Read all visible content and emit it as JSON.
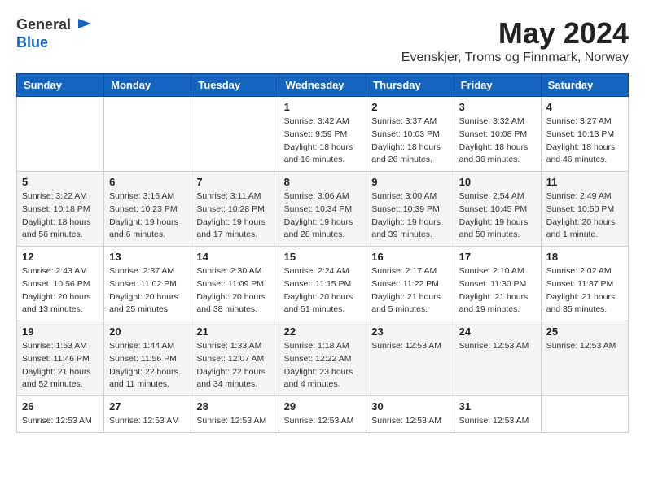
{
  "header": {
    "logo": {
      "line1": "General",
      "line2": "Blue"
    },
    "title": "May 2024",
    "location": "Evenskjer, Troms og Finnmark, Norway"
  },
  "weekdays": [
    "Sunday",
    "Monday",
    "Tuesday",
    "Wednesday",
    "Thursday",
    "Friday",
    "Saturday"
  ],
  "weeks": [
    [
      {
        "day": "",
        "detail": ""
      },
      {
        "day": "",
        "detail": ""
      },
      {
        "day": "",
        "detail": ""
      },
      {
        "day": "1",
        "detail": "Sunrise: 3:42 AM\nSunset: 9:59 PM\nDaylight: 18 hours and 16 minutes."
      },
      {
        "day": "2",
        "detail": "Sunrise: 3:37 AM\nSunset: 10:03 PM\nDaylight: 18 hours and 26 minutes."
      },
      {
        "day": "3",
        "detail": "Sunrise: 3:32 AM\nSunset: 10:08 PM\nDaylight: 18 hours and 36 minutes."
      },
      {
        "day": "4",
        "detail": "Sunrise: 3:27 AM\nSunset: 10:13 PM\nDaylight: 18 hours and 46 minutes."
      }
    ],
    [
      {
        "day": "5",
        "detail": "Sunrise: 3:22 AM\nSunset: 10:18 PM\nDaylight: 18 hours and 56 minutes."
      },
      {
        "day": "6",
        "detail": "Sunrise: 3:16 AM\nSunset: 10:23 PM\nDaylight: 19 hours and 6 minutes."
      },
      {
        "day": "7",
        "detail": "Sunrise: 3:11 AM\nSunset: 10:28 PM\nDaylight: 19 hours and 17 minutes."
      },
      {
        "day": "8",
        "detail": "Sunrise: 3:06 AM\nSunset: 10:34 PM\nDaylight: 19 hours and 28 minutes."
      },
      {
        "day": "9",
        "detail": "Sunrise: 3:00 AM\nSunset: 10:39 PM\nDaylight: 19 hours and 39 minutes."
      },
      {
        "day": "10",
        "detail": "Sunrise: 2:54 AM\nSunset: 10:45 PM\nDaylight: 19 hours and 50 minutes."
      },
      {
        "day": "11",
        "detail": "Sunrise: 2:49 AM\nSunset: 10:50 PM\nDaylight: 20 hours and 1 minute."
      }
    ],
    [
      {
        "day": "12",
        "detail": "Sunrise: 2:43 AM\nSunset: 10:56 PM\nDaylight: 20 hours and 13 minutes."
      },
      {
        "day": "13",
        "detail": "Sunrise: 2:37 AM\nSunset: 11:02 PM\nDaylight: 20 hours and 25 minutes."
      },
      {
        "day": "14",
        "detail": "Sunrise: 2:30 AM\nSunset: 11:09 PM\nDaylight: 20 hours and 38 minutes."
      },
      {
        "day": "15",
        "detail": "Sunrise: 2:24 AM\nSunset: 11:15 PM\nDaylight: 20 hours and 51 minutes."
      },
      {
        "day": "16",
        "detail": "Sunrise: 2:17 AM\nSunset: 11:22 PM\nDaylight: 21 hours and 5 minutes."
      },
      {
        "day": "17",
        "detail": "Sunrise: 2:10 AM\nSunset: 11:30 PM\nDaylight: 21 hours and 19 minutes."
      },
      {
        "day": "18",
        "detail": "Sunrise: 2:02 AM\nSunset: 11:37 PM\nDaylight: 21 hours and 35 minutes."
      }
    ],
    [
      {
        "day": "19",
        "detail": "Sunrise: 1:53 AM\nSunset: 11:46 PM\nDaylight: 21 hours and 52 minutes."
      },
      {
        "day": "20",
        "detail": "Sunrise: 1:44 AM\nSunset: 11:56 PM\nDaylight: 22 hours and 11 minutes."
      },
      {
        "day": "21",
        "detail": "Sunrise: 1:33 AM\nSunset: 12:07 AM\nDaylight: 22 hours and 34 minutes."
      },
      {
        "day": "22",
        "detail": "Sunrise: 1:18 AM\nSunset: 12:22 AM\nDaylight: 23 hours and 4 minutes."
      },
      {
        "day": "23",
        "detail": "Sunrise: 12:53 AM"
      },
      {
        "day": "24",
        "detail": "Sunrise: 12:53 AM"
      },
      {
        "day": "25",
        "detail": "Sunrise: 12:53 AM"
      }
    ],
    [
      {
        "day": "26",
        "detail": "Sunrise: 12:53 AM"
      },
      {
        "day": "27",
        "detail": "Sunrise: 12:53 AM"
      },
      {
        "day": "28",
        "detail": "Sunrise: 12:53 AM"
      },
      {
        "day": "29",
        "detail": "Sunrise: 12:53 AM"
      },
      {
        "day": "30",
        "detail": "Sunrise: 12:53 AM"
      },
      {
        "day": "31",
        "detail": "Sunrise: 12:53 AM"
      },
      {
        "day": "",
        "detail": ""
      }
    ]
  ]
}
